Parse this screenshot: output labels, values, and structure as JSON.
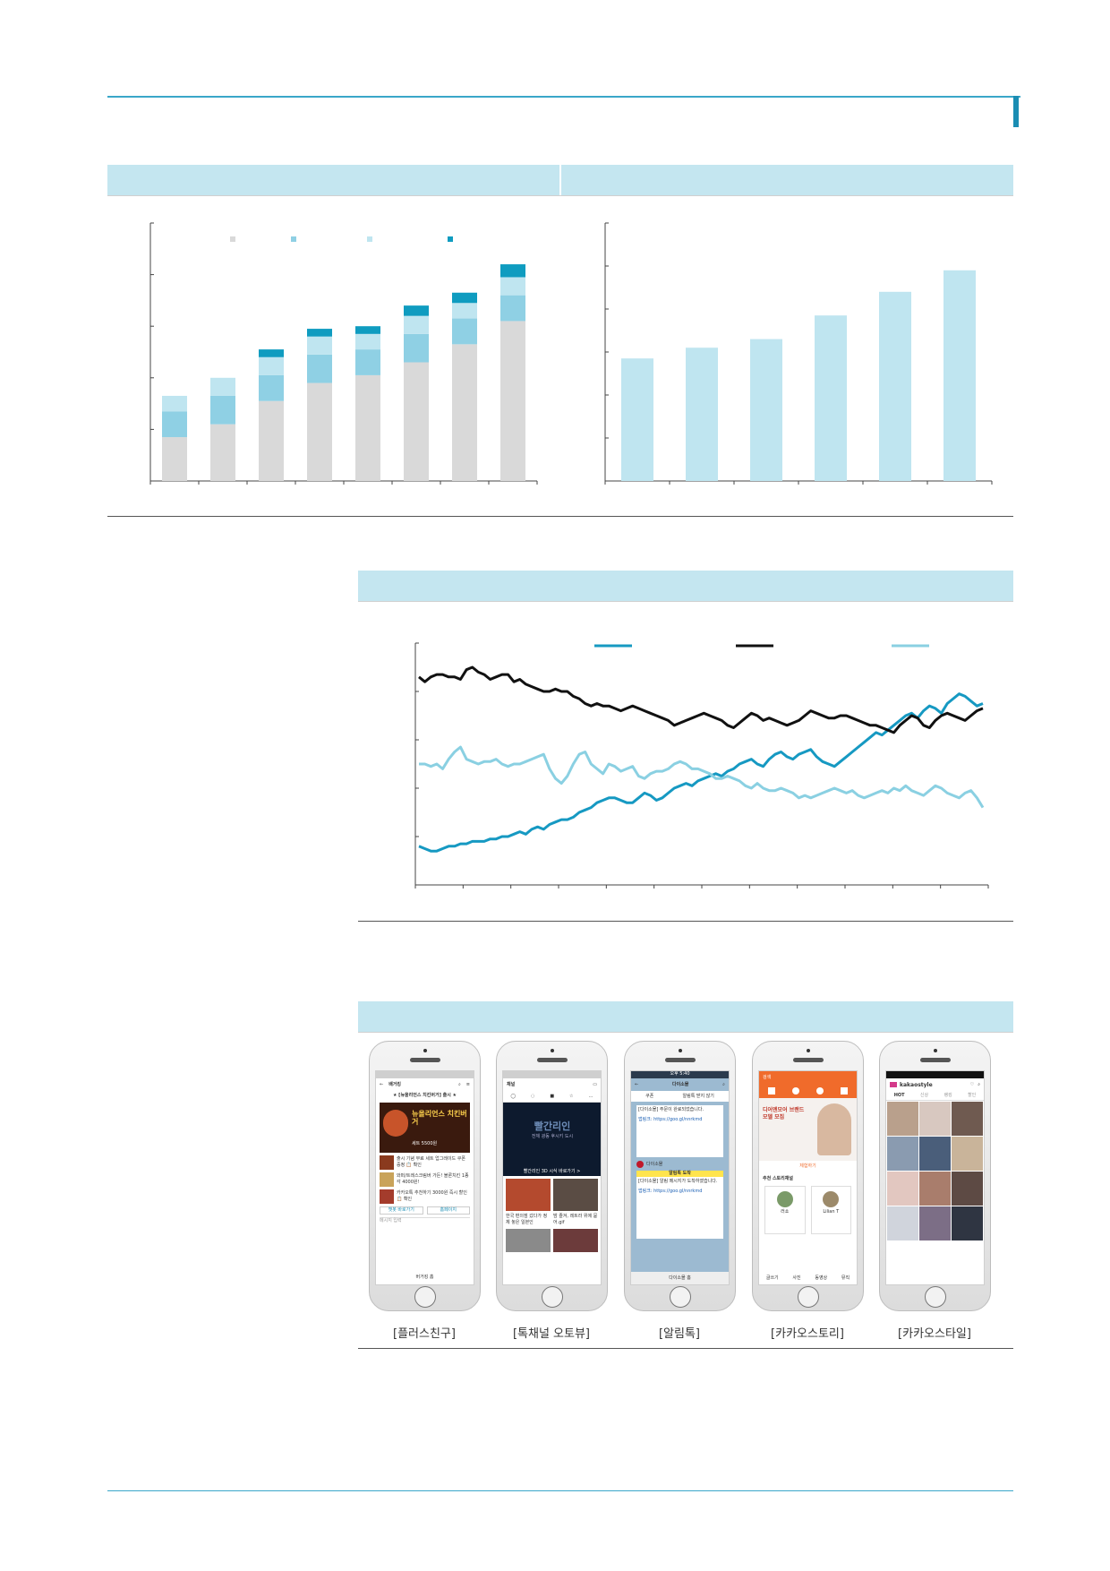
{
  "colors": {
    "accent": "#1aa0c4",
    "band": "#c4e6f0",
    "bar_gray": "#d9d9d9",
    "bar_mid": "#8fd0e4",
    "bar_light": "#bfe5f0",
    "bar_dark": "#0f9cc0",
    "line_teal": "#1699c2",
    "line_black": "#111111",
    "line_light": "#8ad0e2"
  },
  "chart_data": [
    {
      "type": "bar",
      "stacked": true,
      "categories": [
        "",
        "",
        "",
        "",
        "",
        "",
        "",
        ""
      ],
      "series": [
        {
          "values": [
            17,
            22,
            31,
            38,
            41,
            46,
            53,
            62
          ]
        },
        {
          "values": [
            10,
            11,
            10,
            11,
            10,
            11,
            10,
            10
          ]
        },
        {
          "values": [
            6,
            7,
            7,
            7,
            6,
            7,
            6,
            7
          ]
        },
        {
          "values": [
            0,
            0,
            3,
            3,
            3,
            4,
            4,
            5
          ]
        }
      ],
      "ylim": [
        0,
        100
      ],
      "y_ticks": [
        0,
        20,
        40,
        60,
        80,
        100
      ],
      "legend_placement": "top",
      "grid": false
    },
    {
      "type": "bar",
      "categories": [
        "",
        "",
        "",
        "",
        "",
        ""
      ],
      "values": [
        57,
        62,
        66,
        77,
        88,
        98
      ],
      "ylim": [
        0,
        120
      ],
      "y_ticks": [
        0,
        20,
        40,
        60,
        80,
        100,
        120
      ],
      "grid": false
    },
    {
      "type": "line",
      "x_count": 96,
      "ylim": [
        0,
        100
      ],
      "y_ticks": [
        0,
        20,
        40,
        60,
        80,
        100
      ],
      "x_ticks": 13,
      "legend_placement": "top-right",
      "grid": false,
      "series": [
        {
          "values": [
            16,
            15,
            14,
            14,
            15,
            16,
            16,
            17,
            17,
            18,
            18,
            18,
            19,
            19,
            20,
            20,
            21,
            22,
            21,
            23,
            24,
            23,
            25,
            26,
            27,
            27,
            28,
            30,
            31,
            32,
            34,
            35,
            36,
            36,
            35,
            34,
            34,
            36,
            38,
            37,
            35,
            36,
            38,
            40,
            41,
            42,
            41,
            43,
            44,
            45,
            46,
            45,
            47,
            48,
            50,
            51,
            52,
            50,
            49,
            52,
            54,
            55,
            53,
            52,
            54,
            55,
            56,
            53,
            51,
            50,
            49,
            51,
            53,
            55,
            57,
            59,
            61,
            63,
            62,
            64,
            66,
            68,
            70,
            71,
            69,
            72,
            74,
            73,
            71,
            75,
            77,
            79,
            78,
            76,
            74,
            75
          ]
        },
        {
          "values": [
            86,
            84,
            86,
            87,
            87,
            86,
            86,
            85,
            89,
            90,
            88,
            87,
            85,
            86,
            87,
            87,
            84,
            85,
            83,
            82,
            81,
            80,
            80,
            81,
            80,
            80,
            78,
            77,
            75,
            74,
            75,
            74,
            74,
            73,
            72,
            73,
            74,
            73,
            72,
            71,
            70,
            69,
            68,
            66,
            67,
            68,
            69,
            70,
            71,
            70,
            69,
            68,
            66,
            65,
            67,
            69,
            71,
            70,
            68,
            69,
            68,
            67,
            66,
            67,
            68,
            70,
            72,
            71,
            70,
            69,
            69,
            70,
            70,
            69,
            68,
            67,
            66,
            66,
            65,
            64,
            63,
            66,
            68,
            70,
            69,
            66,
            65,
            68,
            70,
            71,
            70,
            69,
            68,
            70,
            72,
            73
          ]
        },
        {
          "values": [
            50,
            50,
            49,
            50,
            48,
            52,
            55,
            57,
            52,
            51,
            50,
            51,
            51,
            52,
            50,
            49,
            50,
            50,
            51,
            52,
            53,
            54,
            48,
            44,
            42,
            45,
            50,
            54,
            55,
            50,
            48,
            46,
            50,
            49,
            47,
            48,
            49,
            45,
            44,
            46,
            47,
            47,
            48,
            50,
            51,
            50,
            48,
            48,
            47,
            46,
            44,
            44,
            45,
            44,
            43,
            41,
            40,
            42,
            40,
            39,
            39,
            40,
            39,
            38,
            36,
            37,
            36,
            37,
            38,
            39,
            40,
            39,
            38,
            39,
            37,
            36,
            37,
            38,
            39,
            38,
            40,
            39,
            41,
            39,
            38,
            37,
            39,
            41,
            40,
            38,
            37,
            36,
            38,
            39,
            36,
            32
          ]
        }
      ]
    }
  ],
  "phones": {
    "plus": {
      "title": "배거킹",
      "notice": "★ [뉴올리언스 치킨버거] 출시 ★",
      "banner_big": "뉴올리언스 치킨버거",
      "banner_price": "세트 5500원",
      "items": [
        "출시 기념 무료 세트 업그레이드 쿠폰 증정 📋 확인",
        "와퍼/트레스크림버 가든! 블론치킨 1종 각 4000원!",
        "카카오톡 추천하기 3000원 즉시 할인 📋 확인"
      ],
      "btn_left": "챗봇 바로가기",
      "btn_right": "홈페이지",
      "input": "메시지 입력",
      "home": "버거킹 홈"
    },
    "channel": {
      "title": "채널",
      "video_title": "빨간리인",
      "video_sub": "전체 광동 후시키 도시",
      "video_caption": "빨간리인 3D 시식 바로가기 >",
      "cap1": "한국 편의점 갔다가 정체 놓은 일본인",
      "cap2": "밤 즐겨, 레트라 위에 묻어.gif"
    },
    "alim": {
      "status": "오후 5:40",
      "title": "다이소몰",
      "tab1": "쿠폰",
      "tab2": "알림톡 받지 않기",
      "badge": "알림톡 도착",
      "sender": "다이소몰",
      "body1": "[다이소몰] 주문이 완료되었습니다.",
      "body2": "[다이소몰] 알림 메시지가 도착하였습니다.",
      "link1": "앱링크: https://goo.gl/nnrkmd",
      "home": "다이소몰 홈"
    },
    "story": {
      "search": "검색",
      "ad_title": "디어엔모어 브랜드 모델 모집",
      "ad_btn": "체험하기",
      "section": "추천 스토리채널",
      "friend1": "러쇼",
      "friend2": "Lilian T",
      "tabs": [
        "글쓰기",
        "사진",
        "동영상",
        "뮤직"
      ]
    },
    "style": {
      "brand": "kakaostyle",
      "tabs": [
        "HOT",
        "신상",
        "랭킹",
        "할인"
      ]
    }
  },
  "captions": [
    "[플러스친구]",
    "[톡채널 오토뷰]",
    "[알림톡]",
    "[카카오스토리]",
    "[카카오스타일]"
  ]
}
